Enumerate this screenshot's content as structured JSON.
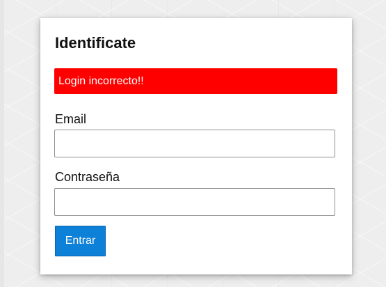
{
  "login": {
    "title": "Identificate",
    "error_message": "Login incorrecto!!",
    "email_label": "Email",
    "email_value": "",
    "password_label": "Contraseña",
    "password_value": "",
    "submit_label": "Entrar"
  },
  "colors": {
    "error": "#ff0000",
    "primary_button": "#0d80d8",
    "card_background": "#ffffff",
    "page_background": "#eeeeee"
  }
}
